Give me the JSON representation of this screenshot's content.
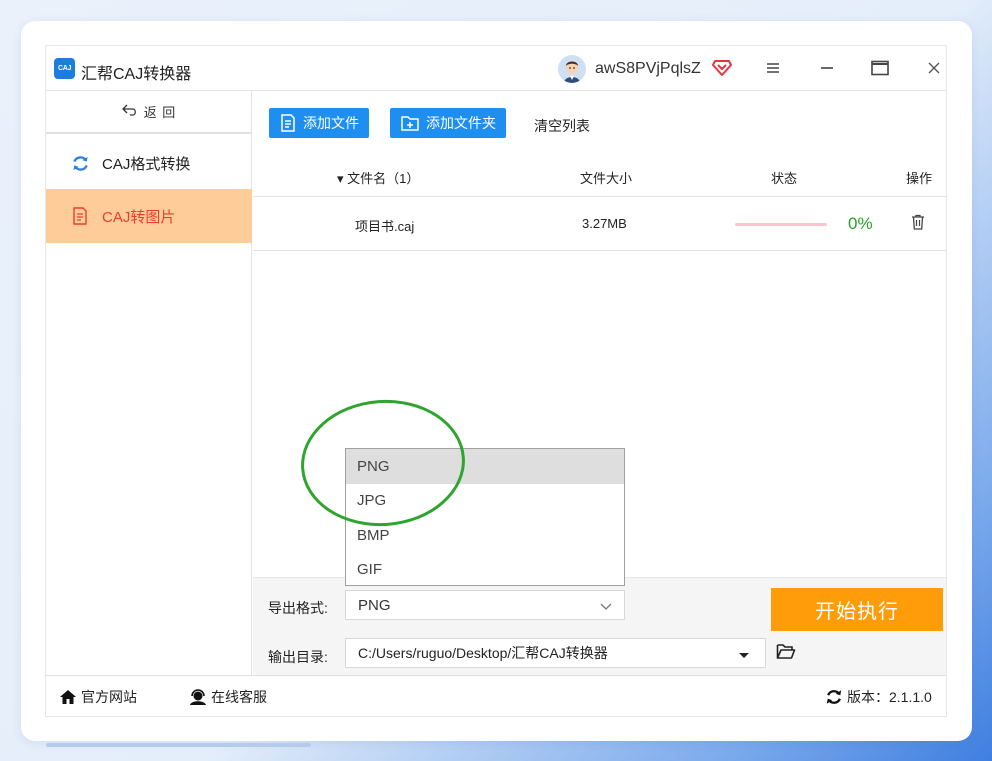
{
  "app": {
    "logo_text": "CAJ",
    "title": "汇帮CAJ转换器",
    "username": "awS8PVjPqlsZ"
  },
  "sidebar": {
    "back_label": "返 回",
    "items": [
      {
        "label": "CAJ格式转换",
        "icon": "refresh-icon"
      },
      {
        "label": "CAJ转图片",
        "icon": "document-icon",
        "active": true
      }
    ]
  },
  "toolbar": {
    "add_file": "添加文件",
    "add_folder": "添加文件夹",
    "clear_list": "清空列表"
  },
  "table": {
    "headers": {
      "filename": "▾ 文件名（1）",
      "size": "文件大小",
      "status": "状态",
      "action": "操作"
    },
    "rows": [
      {
        "filename": "项目书.caj",
        "size": "3.27MB",
        "progress": 0,
        "progress_text": "0%"
      }
    ]
  },
  "settings": {
    "format_label": "导出格式:",
    "format_value": "PNG",
    "format_options": [
      "PNG",
      "JPG",
      "BMP",
      "GIF"
    ],
    "output_label": "输出目录:",
    "output_value": "C:/Users/ruguo/Desktop/汇帮CAJ转换器",
    "start_label": "开始执行"
  },
  "footer": {
    "website": "官方网站",
    "support": "在线客服",
    "version": "版本：2.1.1.0"
  },
  "colors": {
    "accent_blue": "#1f8ef1",
    "active_bg": "#fdcc99",
    "active_text": "#e8402d",
    "start_button": "#ff9c0a",
    "progress_text": "#2aa12a",
    "highlight_circle": "#2fa42f"
  }
}
